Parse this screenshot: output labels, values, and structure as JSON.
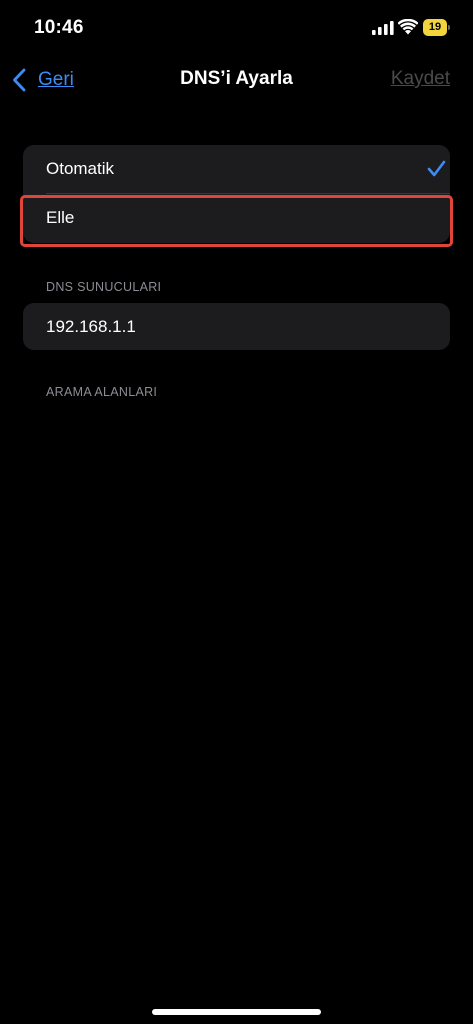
{
  "status_bar": {
    "time": "10:46",
    "battery_level": "19",
    "battery_color": "#f2d43d",
    "icons": [
      "signal-icon",
      "wifi-icon",
      "battery-icon"
    ]
  },
  "nav": {
    "back_label": "Geri",
    "title": "DNS’i Ayarla",
    "save_label": "Kaydet",
    "accent_color": "#3d8cf5"
  },
  "dns_mode": {
    "options": [
      {
        "label": "Otomatik",
        "selected": true
      },
      {
        "label": "Elle",
        "selected": false,
        "highlighted": true
      }
    ],
    "highlight_color": "#e0453a"
  },
  "dns_servers": {
    "header": "DNS SUNUCULARI",
    "entries": [
      "192.168.1.1"
    ]
  },
  "search_domains": {
    "header": "ARAMA ALANLARI"
  }
}
